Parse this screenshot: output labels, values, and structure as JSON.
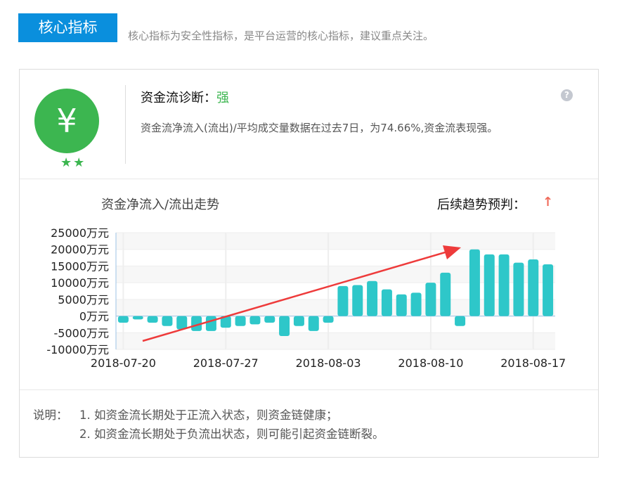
{
  "header": {
    "tag": "核心指标",
    "description": "核心指标为安全性指标，是平台运营的核心指标，建议重点关注。"
  },
  "diagnosis": {
    "coin_symbol": "¥",
    "stars": "★★",
    "title": "资金流诊断：",
    "strength": "强",
    "help_icon": "?",
    "text": "资金流净流入(流出)/平均成交量数据在过去7日，为74.66%,资金流表现强。"
  },
  "trend": {
    "title": "资金净流入/流出走势",
    "prediction_label": "后续趋势预判：",
    "prediction_icon": "↑"
  },
  "chart_data": {
    "type": "bar",
    "y_tick_labels": [
      "25000万元",
      "20000万元",
      "15000万元",
      "10000万元",
      "5000万元",
      "0万元",
      "-5000万元",
      "-10000万元"
    ],
    "x_tick_labels": [
      "2018-07-20",
      "2018-07-27",
      "2018-08-03",
      "2018-08-10",
      "2018-08-17"
    ],
    "ylim": [
      -10000,
      25000
    ],
    "x_start": "2018-07-20",
    "x_end": "2018-08-17",
    "values": [
      -2000,
      -1000,
      -2000,
      -3000,
      -4000,
      -4500,
      -4500,
      -3500,
      -3000,
      -2500,
      -2000,
      -6000,
      -3000,
      -4500,
      -2000,
      9000,
      9300,
      10500,
      8000,
      6500,
      7000,
      10000,
      13000,
      -3000,
      20000,
      18500,
      18500,
      16000,
      17000,
      15500
    ],
    "colors": {
      "bar": "#2ec7c9",
      "arrow": "#ee3b3b",
      "grid": "#eeeeee",
      "band": "#f7f7f7",
      "axis": "#9cc3e4"
    }
  },
  "notes": {
    "label": "说明：",
    "line1": "1. 如资金流长期处于正流入状态，则资金链健康；",
    "line2": "2. 如资金流长期处于负流出状态，则可能引起资金链断裂。"
  }
}
